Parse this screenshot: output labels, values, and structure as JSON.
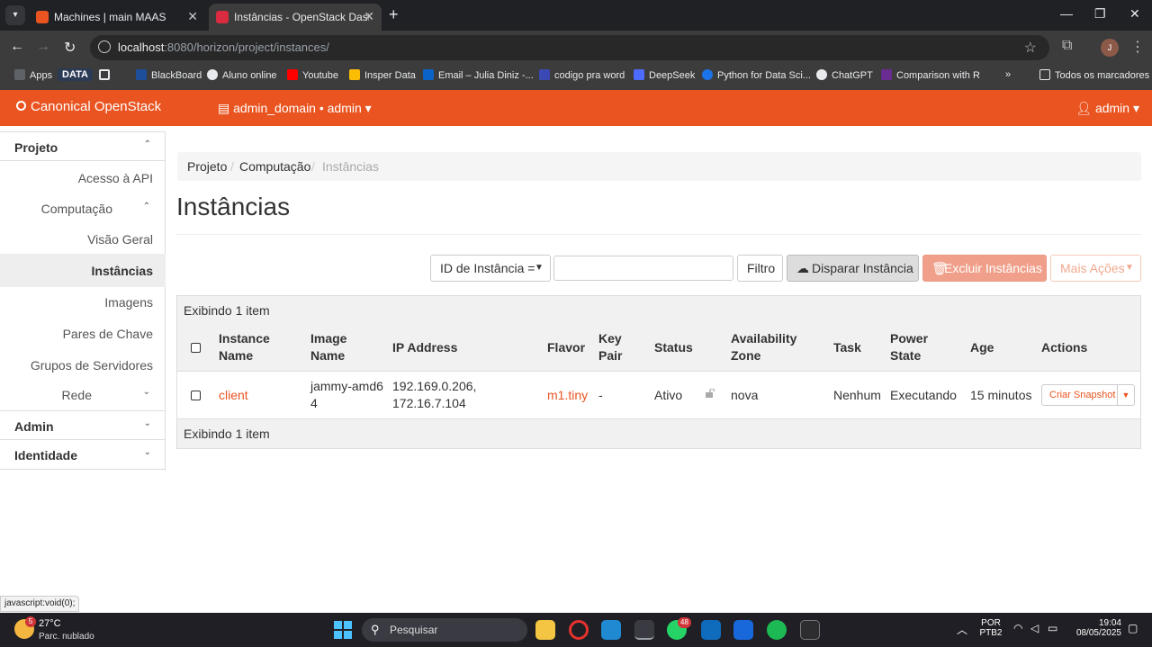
{
  "browser": {
    "tabs": [
      {
        "title": "Machines | main MAAS",
        "close": "✕"
      },
      {
        "title": "Instâncias - OpenStack Dashboard",
        "close": "✕"
      }
    ],
    "new_tab": "+",
    "url_host": "localhost",
    "url_path": ":8080/horizon/project/instances/",
    "profile_initial": "J",
    "window_controls": {
      "minimize": "—",
      "maximize": "❐",
      "close": "✕"
    },
    "bookmarks": [
      {
        "label": "Apps",
        "icon": "apps-grid-icon"
      },
      {
        "label": "DATA",
        "icon": "data-badge"
      },
      {
        "label": "",
        "icon": "grid-icon"
      },
      {
        "label": "BlackBoard",
        "icon": "blackboard-icon"
      },
      {
        "label": "Aluno online",
        "icon": "aluno-icon"
      },
      {
        "label": "Youtube",
        "icon": "youtube-icon"
      },
      {
        "label": "Insper Data",
        "icon": "drive-icon"
      },
      {
        "label": "Email – Julia Diniz -...",
        "icon": "outlook-icon"
      },
      {
        "label": "codigo pra word",
        "icon": "lines-icon"
      },
      {
        "label": "DeepSeek",
        "icon": "deepseek-icon"
      },
      {
        "label": "Python for Data Sci...",
        "icon": "c-icon"
      },
      {
        "label": "ChatGPT",
        "icon": "chatgpt-icon"
      },
      {
        "label": "Comparison with R",
        "icon": "pandas-icon"
      }
    ],
    "bookmarks_overflow": "»",
    "all_bookmarks": "Todos os marcadores"
  },
  "header": {
    "brand": "Canonical OpenStack",
    "domain_selector": "admin_domain • admin",
    "user": "admin"
  },
  "sidebar": {
    "projeto": "Projeto",
    "acesso_api": "Acesso à API",
    "computacao": "Computação",
    "visao_geral": "Visão Geral",
    "instancias": "Instâncias",
    "imagens": "Imagens",
    "pares_chave": "Pares de Chave",
    "grupos_servidores": "Grupos de Servidores",
    "rede": "Rede",
    "admin": "Admin",
    "identidade": "Identidade"
  },
  "breadcrumb": {
    "item1": "Projeto",
    "item2": "Computação",
    "current": "Instâncias",
    "sep": "/"
  },
  "page_title": "Instâncias",
  "toolbar": {
    "filter_field": "ID de Instância =",
    "filter_placeholder": "",
    "filter_button": "Filtro",
    "launch_button": "Disparar Instância",
    "delete_button": "Excluir Instâncias",
    "more_actions": "Mais Ações"
  },
  "table": {
    "caption_top": "Exibindo 1 item",
    "caption_bottom": "Exibindo 1 item",
    "headers": {
      "name_l1": "Instance",
      "name_l2": "Name",
      "image_l1": "Image",
      "image_l2": "Name",
      "ip": "IP Address",
      "flavor": "Flavor",
      "keypair_l1": "Key",
      "keypair_l2": "Pair",
      "status": "Status",
      "az_l1": "Availability",
      "az_l2": "Zone",
      "task": "Task",
      "power_l1": "Power",
      "power_l2": "State",
      "age": "Age",
      "actions": "Actions"
    },
    "rows": [
      {
        "name": "client",
        "image_l1": "jammy-amd6",
        "image_l2": "4",
        "ip_l1": "192.169.0.206,",
        "ip_l2": "172.16.7.104",
        "flavor": "m1.tiny",
        "key_pair": "-",
        "status": "Ativo",
        "availability_zone": "nova",
        "task": "Nenhum",
        "power_state": "Executando",
        "age": "15 minutos",
        "action": "Criar Snapshot"
      }
    ]
  },
  "status_bar": "javascript:void(0);",
  "taskbar": {
    "weather_temp": "27°C",
    "weather_desc": "Parc. nublado",
    "weather_badge": "5",
    "search": "Pesquisar",
    "whatsapp_badge": "48",
    "lang_l1": "POR",
    "lang_l2": "PTB2",
    "time": "19:04",
    "date": "08/05/2025"
  },
  "colors": {
    "brand": "#e95420",
    "chrome_dark": "#202124",
    "taskbar": "#1f1f25"
  }
}
